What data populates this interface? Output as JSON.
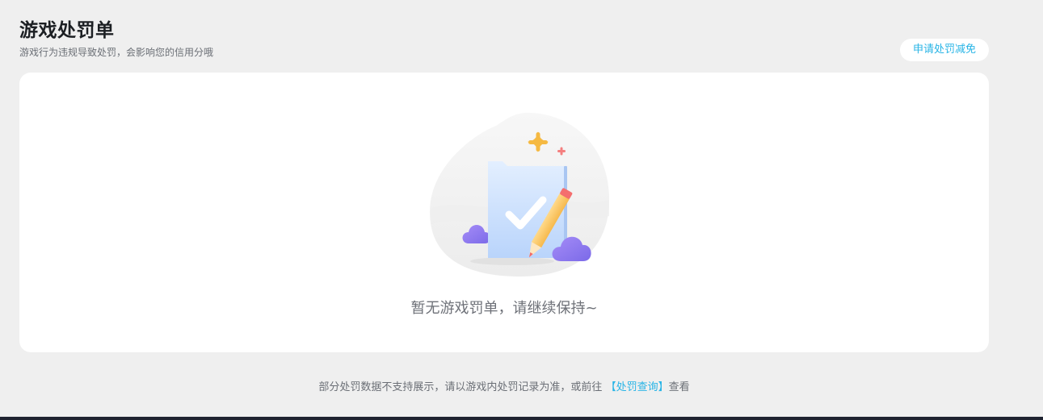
{
  "header": {
    "title": "游戏处罚单",
    "subtitle": "游戏行为违规导致处罚，会影响您的信用分哦",
    "appeal_button": "申请处罚减免"
  },
  "empty_state": {
    "message": "暂无游戏罚单，请继续保持~",
    "icon": "folder-check-pencil-illustration"
  },
  "footer": {
    "note_prefix": "部分处罚数据不支持展示，请以游戏内处罚记录为准，或前往",
    "link_text": "【处罚查询】",
    "note_suffix": "查看"
  },
  "colors": {
    "accent": "#27b4e6",
    "background": "#efefef",
    "card": "#ffffff",
    "title": "#1c1f23"
  }
}
